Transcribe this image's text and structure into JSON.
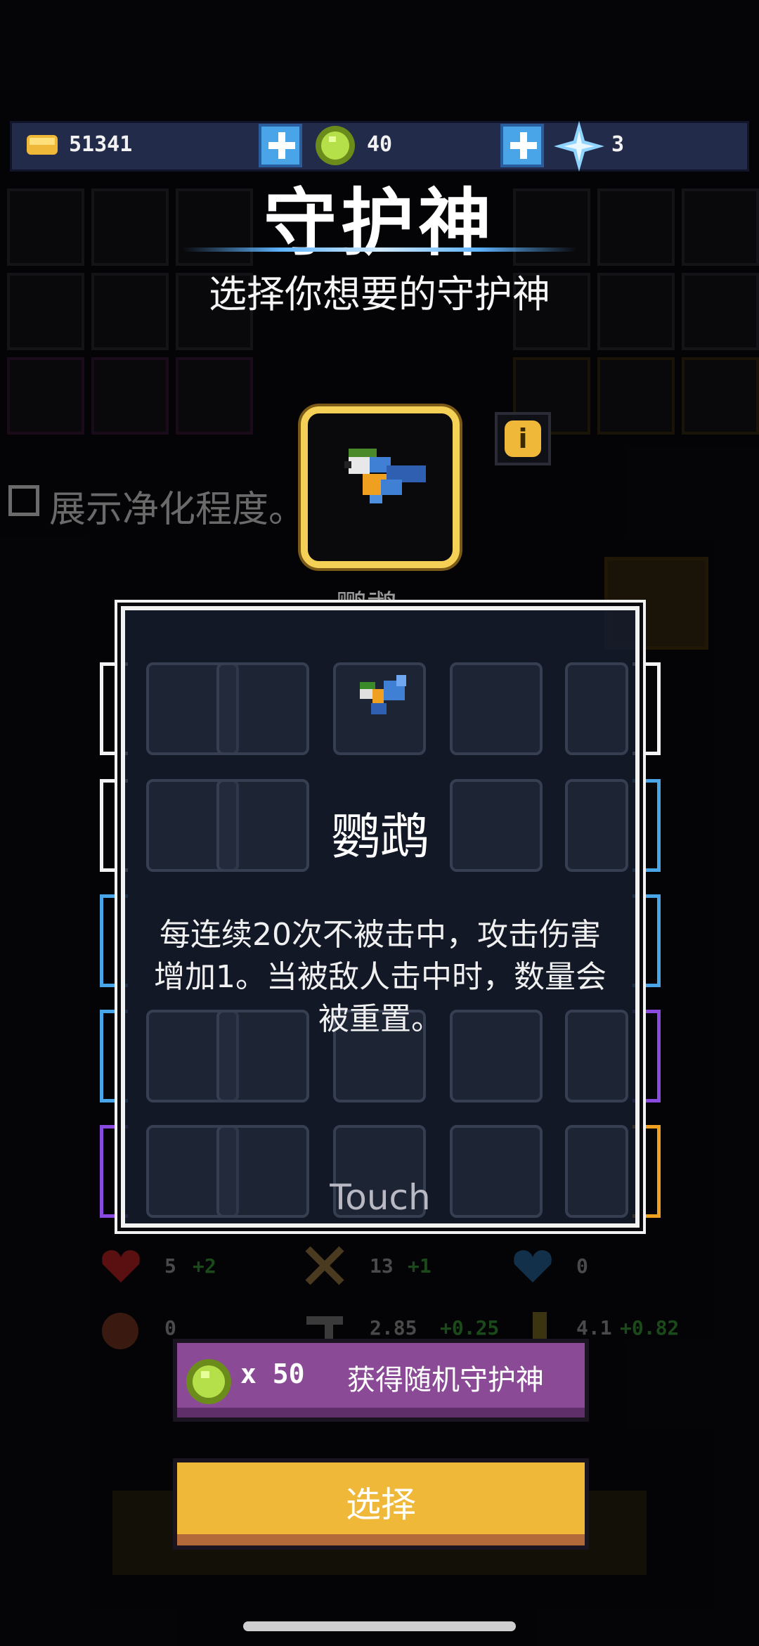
{
  "currency": {
    "coins": "51341",
    "gems": "40",
    "crystals": "3"
  },
  "header": {
    "title": "守护神",
    "subtitle": "选择你想要的守护神"
  },
  "selected_pet": {
    "name_partial": "鹦鹉"
  },
  "filter": {
    "show_purify_label": "展示净化程度。"
  },
  "modal": {
    "name": "鹦鹉",
    "description": "每连续20次不被击中，攻击伤害增加1。当被敌人击中时，数量会被重置。",
    "hint": "Touch"
  },
  "stats": [
    {
      "value": "5",
      "bonus": "+2"
    },
    {
      "value": "13",
      "bonus": "+1"
    },
    {
      "value": "0",
      "bonus": ""
    },
    {
      "value": "0",
      "bonus": ""
    },
    {
      "value": "2.85",
      "bonus": "+0.25"
    },
    {
      "value": "4.1",
      "bonus": "+0.82"
    }
  ],
  "buttons": {
    "random_cost": "x 50",
    "random_label": "获得随机守护神",
    "choose_label": "选择"
  },
  "colors": {
    "accent_gold": "#f5d057",
    "panel_navy": "#232b4a",
    "random_purple": "#8a4a96",
    "choose_yellow": "#f0b838"
  }
}
